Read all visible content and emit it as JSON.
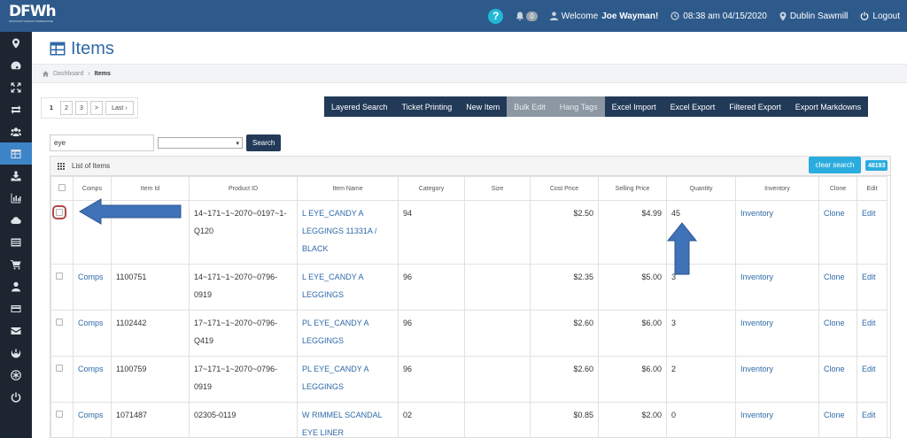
{
  "app": {
    "logo_text": "DFWh",
    "logo_sub": "DISCOUNT FASHION WAREHOUSE"
  },
  "topbar": {
    "notifications": "0",
    "welcome_prefix": "Welcome",
    "user_name": "Joe Wayman!",
    "datetime": "08:38 am 04/15/2020",
    "location": "Dublin Sawmill",
    "logout": "Logout"
  },
  "sidebar": {
    "items": [
      "map-marker-icon",
      "dashboard-icon",
      "expand-icon",
      "exchange-icon",
      "users-icon",
      "table-icon",
      "download-icon",
      "chart-icon",
      "cloud-icon",
      "list-icon",
      "cart-icon",
      "user-icon",
      "card-icon",
      "envelope-icon",
      "rebel-icon",
      "asterisk-icon",
      "power-icon"
    ],
    "active_index": 5
  },
  "page": {
    "title": "Items",
    "breadcrumb": {
      "home": "Dashboard",
      "current": "Items"
    }
  },
  "pager": {
    "pages": [
      "1",
      "2",
      "3"
    ],
    "next": ">",
    "last": "Last ›"
  },
  "toolbar": {
    "buttons": [
      "Layered Search",
      "Ticket Printing",
      "New Item",
      "Bulk Edit",
      "Hang Tags",
      "Excel Import",
      "Excel Export",
      "Filtered Export",
      "Export Markdowns"
    ],
    "disabled": [
      "Bulk Edit",
      "Hang Tags"
    ]
  },
  "search": {
    "value": "eye",
    "select_value": "",
    "button": "Search"
  },
  "list": {
    "title": "List of Items",
    "clear_search": "clear search",
    "count": "48193",
    "columns": [
      "Comps",
      "Item Id",
      "Product ID",
      "Item Name",
      "Category",
      "Size",
      "Cost Price",
      "Selling Price",
      "Quantity",
      "Inventory",
      "Clone",
      "Edit"
    ],
    "rows": [
      {
        "comps": "",
        "item_id": "",
        "product_id": "14~171~1~2070~0197~1-Q120",
        "item_name": "L EYE_CANDY A LEGGINGS 11331A / BLACK",
        "category": "94",
        "size": "",
        "cost": "$2.50",
        "selling": "$4.99",
        "qty": "45",
        "inventory": "Inventory",
        "clone": "Clone",
        "edit": "Edit"
      },
      {
        "comps": "Comps",
        "item_id": "1100751",
        "product_id": "14~171~1~2070~0796-0919",
        "item_name": "L EYE_CANDY A LEGGINGS",
        "category": "96",
        "size": "",
        "cost": "$2.35",
        "selling": "$5.00",
        "qty": "3",
        "inventory": "Inventory",
        "clone": "Clone",
        "edit": "Edit"
      },
      {
        "comps": "Comps",
        "item_id": "1102442",
        "product_id": "17~171~1~2070~0796-Q419",
        "item_name": "PL EYE_CANDY A LEGGINGS",
        "category": "96",
        "size": "",
        "cost": "$2.60",
        "selling": "$6.00",
        "qty": "3",
        "inventory": "Inventory",
        "clone": "Clone",
        "edit": "Edit"
      },
      {
        "comps": "Comps",
        "item_id": "1100759",
        "product_id": "17~171~1~2070~0796-0919",
        "item_name": "PL EYE_CANDY A LEGGINGS",
        "category": "96",
        "size": "",
        "cost": "$2.60",
        "selling": "$6.00",
        "qty": "2",
        "inventory": "Inventory",
        "clone": "Clone",
        "edit": "Edit"
      },
      {
        "comps": "Comps",
        "item_id": "1071487",
        "product_id": "02305-0119",
        "item_name": "W RIMMEL SCANDAL EYE LINER",
        "category": "02",
        "size": "",
        "cost": "$0.85",
        "selling": "$2.00",
        "qty": "0",
        "inventory": "Inventory",
        "clone": "Clone",
        "edit": "Edit"
      }
    ]
  },
  "colors": {
    "navbar": "#2e5a8b",
    "sidebar": "#1d2530",
    "accent": "#2bacdf",
    "toolbar": "#223a58",
    "arrow": "#3f72b8"
  }
}
